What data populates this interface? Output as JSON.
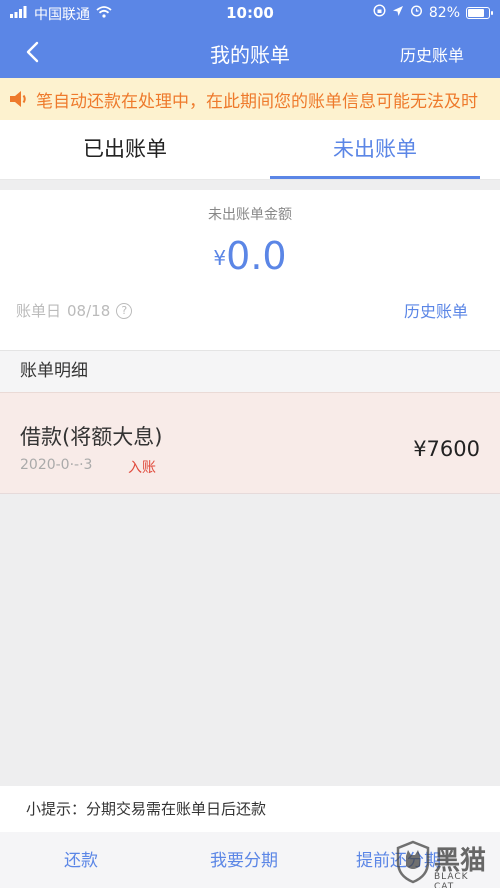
{
  "status_bar": {
    "carrier": "中国联通",
    "time": "10:00",
    "battery": "82%",
    "battery_level": 0.82
  },
  "nav": {
    "title": "我的账单",
    "right_link": "历史账单"
  },
  "notice": {
    "text": "笔自动还款在处理中，在此期间您的账单信息可能无法及时"
  },
  "tabs": [
    {
      "label": "已出账单",
      "active": false
    },
    {
      "label": "未出账单",
      "active": true
    }
  ],
  "summary": {
    "label": "未出账单金额",
    "currency": "¥",
    "amount": "0.0",
    "bill_day_label": "账单日",
    "bill_day": "08/18",
    "history_link": "历史账单"
  },
  "details": {
    "header": "账单明细",
    "rows": [
      {
        "title": "借款(将额大息)",
        "date": "2020-0·-·3",
        "tag": "入账",
        "amount": "¥7600"
      }
    ]
  },
  "tip": "小提示：分期交易需在账单日后还款",
  "bottom_bar": {
    "repay": "还款",
    "installment": "我要分期",
    "early_repay": "提前还分期"
  },
  "watermark": {
    "text": "黑猫",
    "sub": "BLACK CAT"
  },
  "colors": {
    "primary": "#5b86e6",
    "notice_bg": "#fdf2cf",
    "notice_text": "#ee7a2c",
    "tag_red": "#e04a3c"
  }
}
